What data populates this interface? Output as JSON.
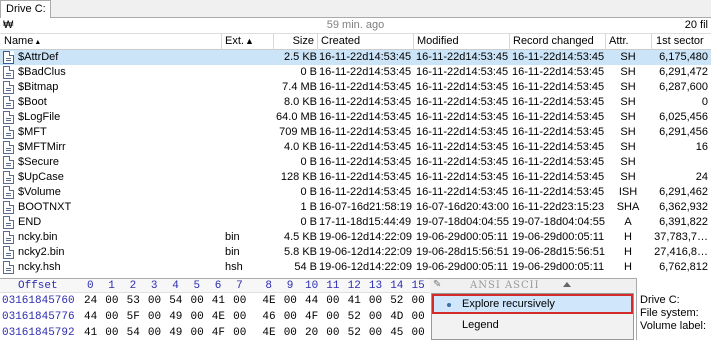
{
  "tab": {
    "label": "Drive C:"
  },
  "status": {
    "hash": "₩",
    "updated": "59 min. ago",
    "file_count": "20 fil"
  },
  "columns": {
    "name": "Name",
    "ext": "Ext.",
    "size": "Size",
    "created": "Created",
    "modified": "Modified",
    "record_changed": "Record changed",
    "attr": "Attr.",
    "first_sector": "1st sector"
  },
  "files": [
    {
      "name": "$AttrDef",
      "ext": "",
      "size": "2.5 KB",
      "created": "16-11-22d14:53:45",
      "modified": "16-11-22d14:53:45",
      "changed": "16-11-22d14:53:45",
      "attr": "SH",
      "sector": "6,175,480",
      "selected": true
    },
    {
      "name": "$BadClus",
      "ext": "",
      "size": "0 B",
      "created": "16-11-22d14:53:45",
      "modified": "16-11-22d14:53:45",
      "changed": "16-11-22d14:53:45",
      "attr": "SH",
      "sector": "6,291,472"
    },
    {
      "name": "$Bitmap",
      "ext": "",
      "size": "7.4 MB",
      "created": "16-11-22d14:53:45",
      "modified": "16-11-22d14:53:45",
      "changed": "16-11-22d14:53:45",
      "attr": "SH",
      "sector": "6,287,600"
    },
    {
      "name": "$Boot",
      "ext": "",
      "size": "8.0 KB",
      "created": "16-11-22d14:53:45",
      "modified": "16-11-22d14:53:45",
      "changed": "16-11-22d14:53:45",
      "attr": "SH",
      "sector": "0"
    },
    {
      "name": "$LogFile",
      "ext": "",
      "size": "64.0 MB",
      "created": "16-11-22d14:53:45",
      "modified": "16-11-22d14:53:45",
      "changed": "16-11-22d14:53:45",
      "attr": "SH",
      "sector": "6,025,456"
    },
    {
      "name": "$MFT",
      "ext": "",
      "size": "709 MB",
      "created": "16-11-22d14:53:45",
      "modified": "16-11-22d14:53:45",
      "changed": "16-11-22d14:53:45",
      "attr": "SH",
      "sector": "6,291,456"
    },
    {
      "name": "$MFTMirr",
      "ext": "",
      "size": "4.0 KB",
      "created": "16-11-22d14:53:45",
      "modified": "16-11-22d14:53:45",
      "changed": "16-11-22d14:53:45",
      "attr": "SH",
      "sector": "16"
    },
    {
      "name": "$Secure",
      "ext": "",
      "size": "0 B",
      "created": "16-11-22d14:53:45",
      "modified": "16-11-22d14:53:45",
      "changed": "16-11-22d14:53:45",
      "attr": "SH",
      "sector": ""
    },
    {
      "name": "$UpCase",
      "ext": "",
      "size": "128 KB",
      "created": "16-11-22d14:53:45",
      "modified": "16-11-22d14:53:45",
      "changed": "16-11-22d14:53:45",
      "attr": "SH",
      "sector": "24"
    },
    {
      "name": "$Volume",
      "ext": "",
      "size": "0 B",
      "created": "16-11-22d14:53:45",
      "modified": "16-11-22d14:53:45",
      "changed": "16-11-22d14:53:45",
      "attr": "ISH",
      "sector": "6,291,462"
    },
    {
      "name": "BOOTNXT",
      "ext": "",
      "size": "1 B",
      "created": "16-07-16d21:58:19",
      "modified": "16-07-16d20:43:00",
      "changed": "16-11-22d23:15:23",
      "attr": "SHA",
      "sector": "6,362,932"
    },
    {
      "name": "END",
      "ext": "",
      "size": "0 B",
      "created": "17-11-18d15:44:49",
      "modified": "19-07-18d04:04:55",
      "changed": "19-07-18d04:04:55",
      "attr": "A",
      "sector": "6,391,822"
    },
    {
      "name": "ncky.bin",
      "ext": "bin",
      "size": "4.5 KB",
      "created": "19-06-12d14:22:09",
      "modified": "19-06-29d00:05:11",
      "changed": "19-06-29d00:05:11",
      "attr": "H",
      "sector": "37,783,7…"
    },
    {
      "name": "ncky2.bin",
      "ext": "bin",
      "size": "5.8 KB",
      "created": "19-06-12d14:22:09",
      "modified": "19-06-28d15:56:51",
      "changed": "19-06-28d15:56:51",
      "attr": "H",
      "sector": "27,416,8…"
    },
    {
      "name": "ncky.hsh",
      "ext": "hsh",
      "size": "54 B",
      "created": "19-06-12d14:22:09",
      "modified": "19-06-29d00:05:11",
      "changed": "19-06-29d00:05:11",
      "attr": "H",
      "sector": "6,762,812"
    }
  ],
  "hex": {
    "offset_label": "Offset",
    "columns": [
      "0",
      "1",
      "2",
      "3",
      "4",
      "5",
      "6",
      "7",
      "8",
      "9",
      "10",
      "11",
      "12",
      "13",
      "14",
      "15"
    ],
    "rows": [
      {
        "offset": "03161845760",
        "bytes": [
          "24",
          "00",
          "53",
          "00",
          "54",
          "00",
          "41",
          "00",
          "4E",
          "00",
          "44",
          "00",
          "41",
          "00",
          "52",
          "00"
        ]
      },
      {
        "offset": "03161845776",
        "bytes": [
          "44",
          "00",
          "5F",
          "00",
          "49",
          "00",
          "4E",
          "00",
          "46",
          "00",
          "4F",
          "00",
          "52",
          "00",
          "4D",
          "00"
        ]
      },
      {
        "offset": "03161845792",
        "bytes": [
          "41",
          "00",
          "54",
          "00",
          "49",
          "00",
          "4F",
          "00",
          "4E",
          "00",
          "20",
          "00",
          "52",
          "00",
          "45",
          "00"
        ]
      }
    ]
  },
  "ascii_bar": {
    "label": "ANSI ASCII"
  },
  "context_menu": {
    "items": [
      {
        "label": "Explore recursively",
        "highlighted": true
      },
      {
        "label": "Legend",
        "highlighted": false
      }
    ]
  },
  "volume_info": {
    "drive": "Drive C:",
    "fs": "File system:",
    "label": "Volume label:"
  },
  "colors": {
    "selection": "#cce4f7",
    "offset_blue": "#2c2cb0",
    "highlight_border": "#d42a2a"
  }
}
